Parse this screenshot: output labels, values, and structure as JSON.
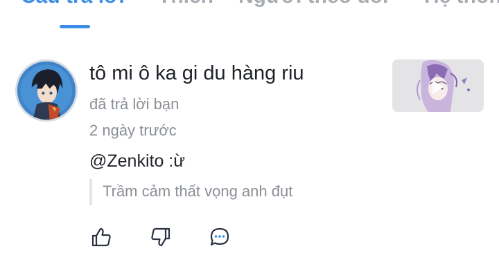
{
  "tabs": [
    {
      "label": "Câu trả lời",
      "active": true
    },
    {
      "label": "Thích",
      "active": false
    },
    {
      "label": "Người theo dõi",
      "active": false
    },
    {
      "label": "Hệ thống",
      "active": false
    }
  ],
  "notification": {
    "user_name": "tô mi ô ka gi du hàng riu",
    "action_text": "đã trả lời bạn",
    "time_ago": "2 ngày trước",
    "reply_text": "@Zenkito :ừ",
    "quoted_text": "Trầm cảm thất vọng anh đụt"
  },
  "actions": {
    "like_icon": "thumbs-up-icon",
    "dislike_icon": "thumbs-down-icon",
    "comment_icon": "comment-icon"
  },
  "colors": {
    "accent": "#3a8ee6",
    "text_primary": "#1f2329",
    "text_secondary": "#8a8f96"
  }
}
